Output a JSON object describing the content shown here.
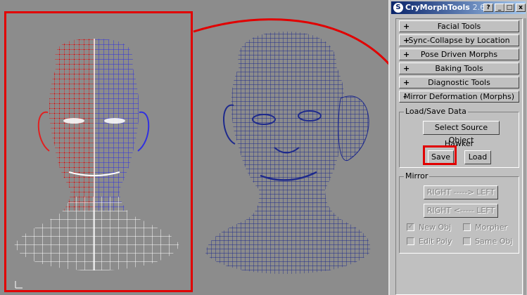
{
  "window": {
    "title": "CryMorphTools",
    "version": "2.6",
    "icon": "3ds-max-logo-icon",
    "controls": [
      "?",
      "_",
      "□",
      "x"
    ]
  },
  "rollouts": [
    {
      "sign": "+",
      "label": "Facial Tools"
    },
    {
      "sign": "+",
      "label": "Sync-Collapse by Location"
    },
    {
      "sign": "+",
      "label": "Pose Driven Morphs"
    },
    {
      "sign": "+",
      "label": "Baking Tools"
    },
    {
      "sign": "+",
      "label": "Diagnostic Tools"
    },
    {
      "sign": "-",
      "label": "Mirror Deformation (Morphs)"
    }
  ],
  "load_save": {
    "group_label": "Load/Save Data",
    "select_button": "Select Source Object",
    "object_name": "Hawker",
    "save_button": "Save",
    "load_button": "Load"
  },
  "mirror": {
    "group_label": "Mirror",
    "right_to_left": "RIGHT -----> LEFT",
    "left_to_right": "RIGHT <----- LEFT",
    "new_obj": {
      "label": "New Obj",
      "checked": true
    },
    "morpher": {
      "label": "Morpher",
      "checked": false
    },
    "edit_poly": {
      "label": "Edit Poly",
      "checked": false
    },
    "same_obj": {
      "label": "Same Obj",
      "checked": false
    }
  },
  "colors": {
    "annotation": "#e10000",
    "wire_left": "#e02020",
    "wire_right": "#3030e0",
    "mesh_blue": "#1e2a8c"
  }
}
